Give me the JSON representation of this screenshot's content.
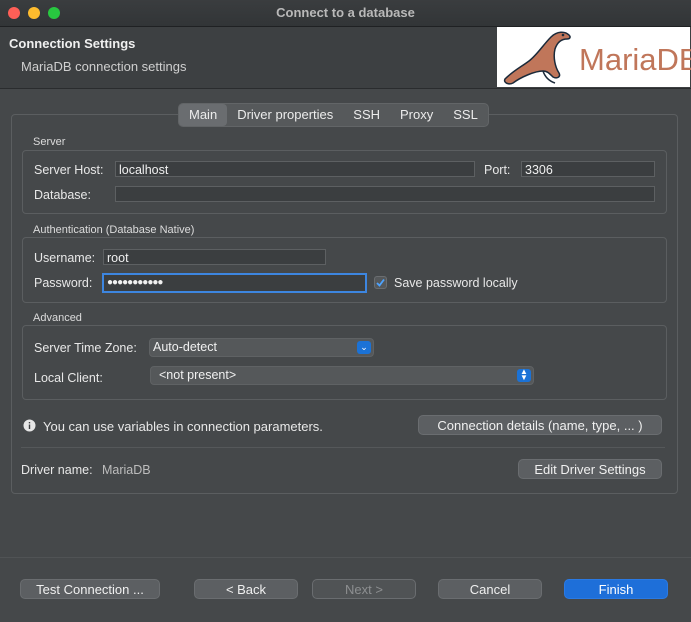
{
  "window": {
    "title": "Connect to a database"
  },
  "header": {
    "title": "Connection Settings",
    "subtitle": "MariaDB connection settings",
    "logo_text": "MariaDB"
  },
  "tabs": [
    {
      "label": "Main",
      "active": true
    },
    {
      "label": "Driver properties",
      "active": false
    },
    {
      "label": "SSH",
      "active": false
    },
    {
      "label": "Proxy",
      "active": false
    },
    {
      "label": "SSL",
      "active": false
    }
  ],
  "server": {
    "group_label": "Server",
    "host_label": "Server Host:",
    "host_value": "localhost",
    "port_label": "Port:",
    "port_value": "3306",
    "database_label": "Database:",
    "database_value": ""
  },
  "auth": {
    "group_label": "Authentication (Database Native)",
    "username_label": "Username:",
    "username_value": "root",
    "password_label": "Password:",
    "password_value": "●●●●●●●●●●●",
    "save_password_label": "Save password locally",
    "save_password_checked": true
  },
  "advanced": {
    "group_label": "Advanced",
    "timezone_label": "Server Time Zone:",
    "timezone_value": "Auto-detect",
    "client_label": "Local Client:",
    "client_value": "<not present>"
  },
  "info": {
    "text": "You can use variables in connection parameters.",
    "details_button": "Connection details (name, type, ... )"
  },
  "driver": {
    "name_label": "Driver name:",
    "name_value": "MariaDB",
    "edit_button": "Edit Driver Settings"
  },
  "footer": {
    "test_button": "Test Connection ...",
    "back_button": "< Back",
    "next_button": "Next >",
    "cancel_button": "Cancel",
    "finish_button": "Finish"
  },
  "colors": {
    "accent": "#1e6fd9",
    "close": "#ff5f57",
    "minimize": "#febc2e",
    "maximize": "#28c840"
  }
}
